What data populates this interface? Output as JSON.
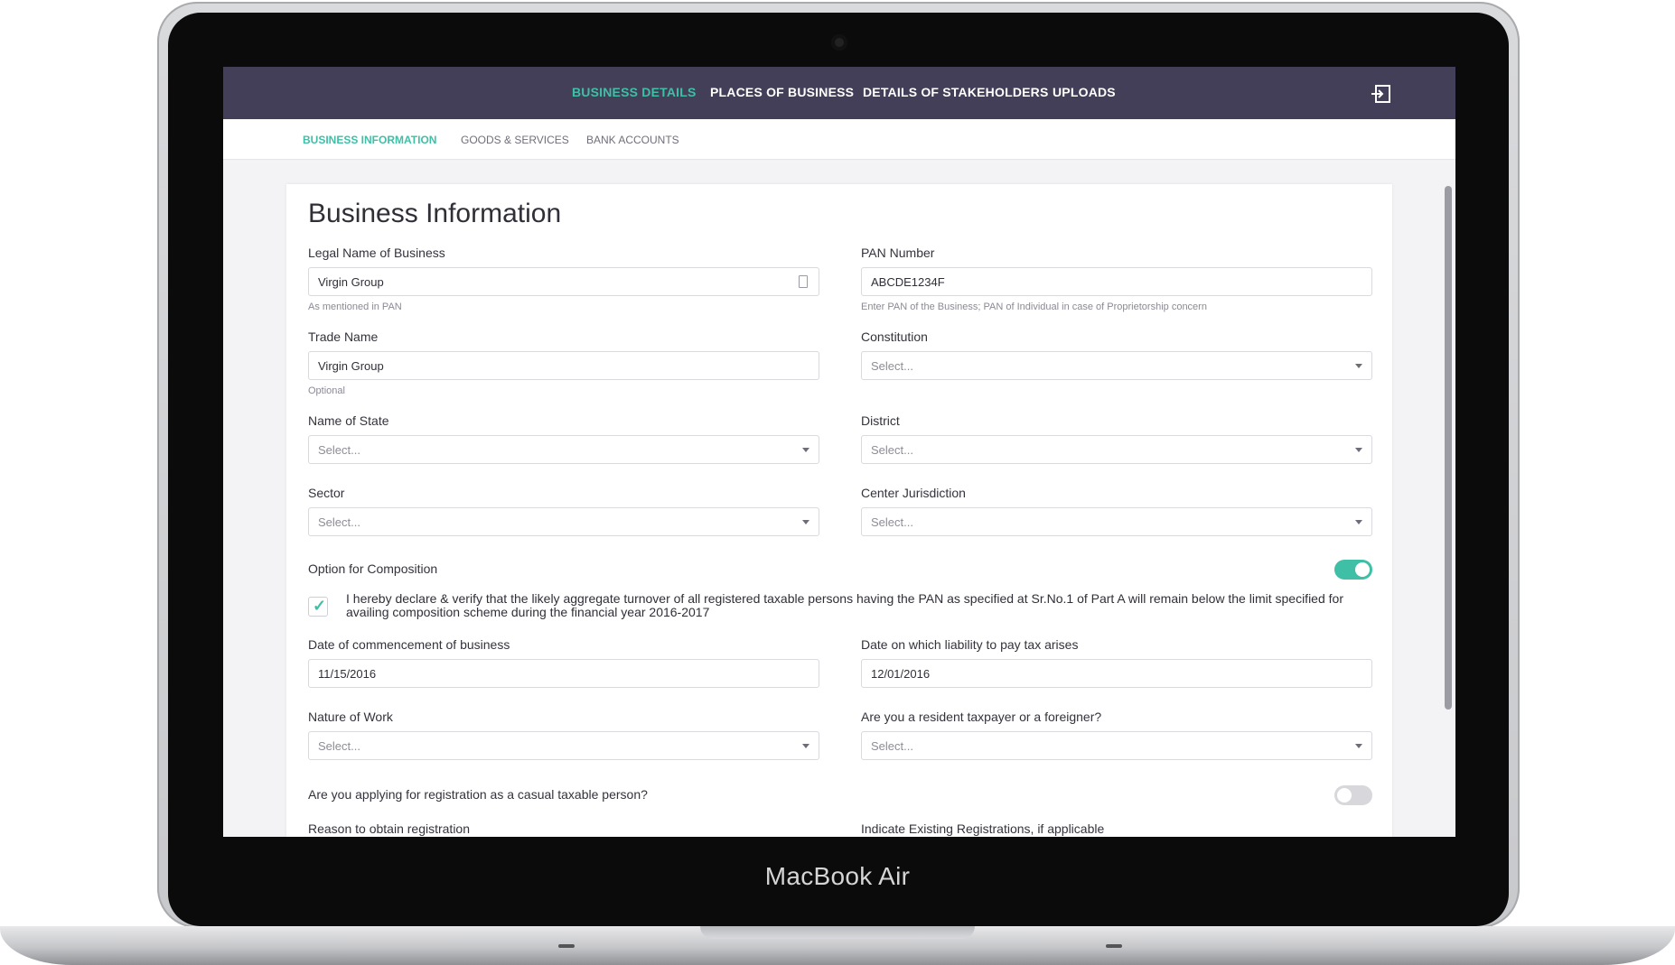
{
  "device": {
    "brand_label": "MacBook Air"
  },
  "topnav": {
    "items": [
      {
        "label": "BUSINESS DETAILS",
        "active": true
      },
      {
        "label": "PLACES OF BUSINESS",
        "active": false
      },
      {
        "label": "DETAILS OF STAKEHOLDERS",
        "active": false
      },
      {
        "label": "UPLOADS",
        "active": false
      }
    ],
    "logout_icon": "logout-icon"
  },
  "subnav": {
    "tabs": [
      {
        "label": "BUSINESS INFORMATION",
        "active": true
      },
      {
        "label": "GOODS & SERVICES",
        "active": false
      },
      {
        "label": "BANK ACCOUNTS",
        "active": false
      }
    ]
  },
  "form": {
    "title": "Business Information",
    "legal_name": {
      "label": "Legal Name of Business",
      "value": "Virgin Group",
      "hint": "As mentioned in PAN"
    },
    "pan": {
      "label": "PAN Number",
      "value": "ABCDE1234F",
      "hint": "Enter PAN of the Business; PAN of Individual in case of Proprietorship concern"
    },
    "trade_name": {
      "label": "Trade Name",
      "value": "Virgin Group",
      "hint": "Optional"
    },
    "constitution": {
      "label": "Constitution",
      "placeholder": "Select..."
    },
    "state": {
      "label": "Name of State",
      "placeholder": "Select..."
    },
    "district": {
      "label": "District",
      "placeholder": "Select..."
    },
    "sector": {
      "label": "Sector",
      "placeholder": "Select..."
    },
    "center_jurisdiction": {
      "label": "Center Jurisdiction",
      "placeholder": "Select..."
    },
    "composition": {
      "label": "Option for Composition",
      "enabled": true
    },
    "declaration": {
      "checked": true,
      "text": "I hereby declare & verify that the likely aggregate turnover of all registered taxable persons having the PAN as specified at Sr.No.1 of Part A will remain below the limit specified for availing composition scheme during the financial year 2016-2017"
    },
    "commencement_date": {
      "label": "Date of commencement of business",
      "value": "11/15/2016"
    },
    "liability_date": {
      "label": "Date on which liability to pay tax arises",
      "value": "12/01/2016"
    },
    "nature_of_work": {
      "label": "Nature of Work",
      "placeholder": "Select..."
    },
    "resident": {
      "label": "Are you a resident taxpayer or a foreigner?",
      "placeholder": "Select..."
    },
    "casual": {
      "label": "Are you applying for registration as a casual taxable person?",
      "enabled": false
    },
    "reason": {
      "label": "Reason to obtain registration"
    },
    "existing": {
      "label": "Indicate Existing Registrations, if applicable"
    }
  },
  "colors": {
    "accent": "#3fbfa6",
    "nav_bg": "#433f58"
  }
}
